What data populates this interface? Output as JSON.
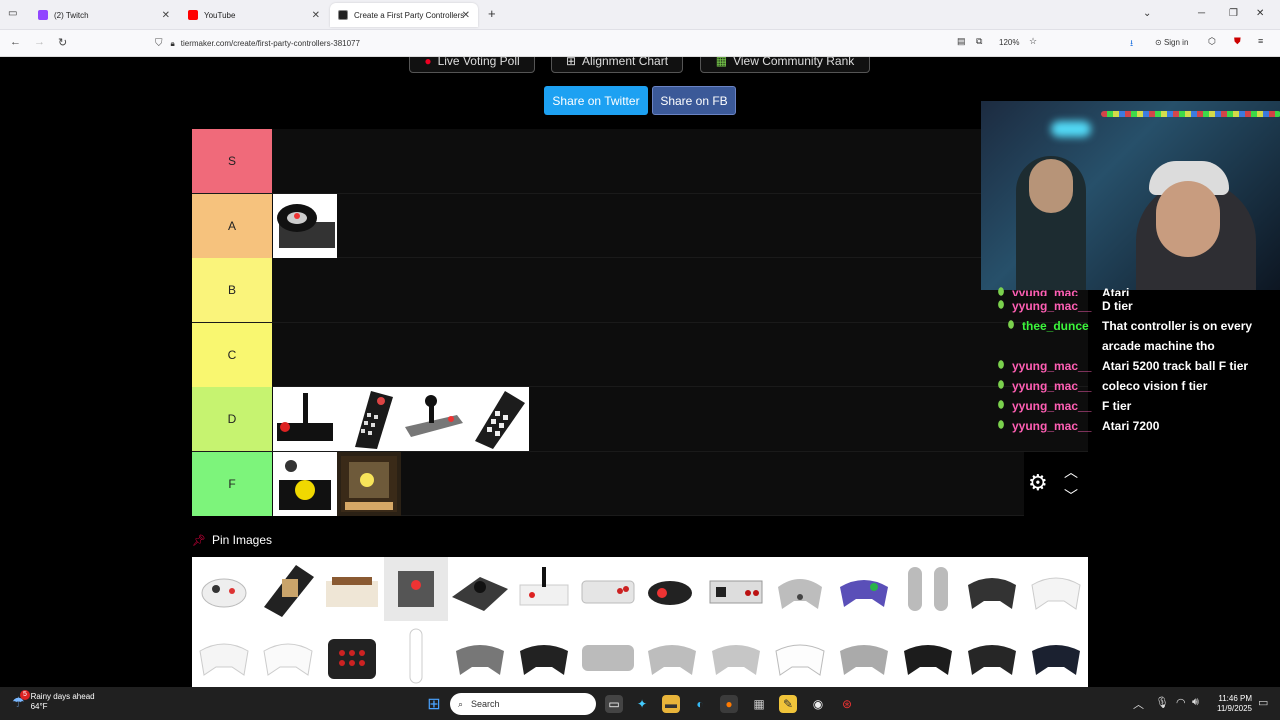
{
  "browser": {
    "tabs": [
      {
        "title": "(2) Twitch",
        "favicon_color": "#9146ff"
      },
      {
        "title": "YouTube",
        "favicon_color": "#ff0000"
      },
      {
        "title": "Create a First Party Controllers",
        "favicon_color": "#222222"
      }
    ],
    "new_tab": "+",
    "url": "tiermaker.com/create/first-party-controllers-381077",
    "zoom": "120%",
    "signin": "Sign in"
  },
  "page": {
    "top_buttons": [
      {
        "label": "Live Voting Poll",
        "icon": "record-icon"
      },
      {
        "label": "Alignment Chart",
        "icon": "grid-icon"
      },
      {
        "label": "View Community Rank",
        "icon": "chart-icon"
      }
    ],
    "share_twitter": "Share on Twitter",
    "share_fb": "Share on FB",
    "tiers": [
      {
        "label": "S",
        "color": "#f06a7a",
        "items": []
      },
      {
        "label": "A",
        "color": "#f6c27d",
        "items": [
          "steering-wheel"
        ]
      },
      {
        "label": "B",
        "color": "#faf47b",
        "items": []
      },
      {
        "label": "C",
        "color": "#f9f770",
        "items": []
      },
      {
        "label": "D",
        "color": "#c6f370",
        "items": [
          "atari-joystick",
          "keypad-controller",
          "flight-stick",
          "coleco-keypad"
        ]
      },
      {
        "label": "F",
        "color": "#7df47b",
        "items": [
          "atari-trackball",
          "atari-7200"
        ]
      }
    ],
    "pin_images": "Pin Images"
  },
  "chat": [
    {
      "user": "yyung_mac__",
      "message": "Atari",
      "user_color": "#ff5fb4"
    },
    {
      "user": "yyung_mac__",
      "message": "D tier",
      "user_color": "#ff5fb4"
    },
    {
      "user": "thee_dunce",
      "message": "That controller is on every arcade machine tho",
      "user_color": "#3cf53c"
    },
    {
      "user": "yyung_mac__",
      "message": "Atari 5200 track ball F tier",
      "user_color": "#ff5fb4"
    },
    {
      "user": "yyung_mac__",
      "message": "coleco vision f tier",
      "user_color": "#ff5fb4"
    },
    {
      "user": "yyung_mac__",
      "message": "F tier",
      "user_color": "#ff5fb4"
    },
    {
      "user": "yyung_mac__",
      "message": "Atari 7200",
      "user_color": "#ff5fb4"
    }
  ],
  "taskbar": {
    "weather_title": "Rainy days ahead",
    "weather_temp": "64°F",
    "weather_badge": "5",
    "search": "Search",
    "time": "11:46 PM",
    "date": "11/9/2025"
  }
}
